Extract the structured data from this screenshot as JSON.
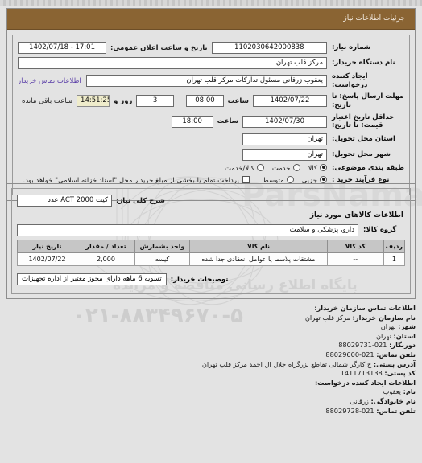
{
  "header": {
    "title": "جزئیات اطلاعات نیاز"
  },
  "fields": {
    "need_number_label": "شماره نیاز:",
    "need_number_value": "1102030642000838",
    "announce_label": "تاریخ و ساعت اعلان عمومی:",
    "announce_value": "1402/07/18 - 17:01",
    "buyer_org_label": "نام دستگاه خریدار:",
    "buyer_org_value": "مرکز قلب تهران",
    "creator_label": "ایجاد کننده درخواست:",
    "creator_value": "یعقوب زرقانی مسئول تدارکات مرکز قلب تهران",
    "contact_link": "اطلاعات تماس خریدار",
    "deadline_label": "مهلت ارسال پاسخ: تا تاریخ:",
    "deadline_date": "1402/07/22",
    "hour_label": "ساعت",
    "deadline_time": "08:00",
    "days_value": "3",
    "days_label": "روز و",
    "remaining_time": "14:51:25",
    "remaining_label": "ساعت باقی مانده",
    "valid_label": "حداقل تاریخ اعتبار قیمت: تا تاریخ:",
    "valid_date": "1402/07/30",
    "valid_time": "18:00",
    "province_label": "استان محل تحویل:",
    "province_value": "تهران",
    "city_label": "شهر محل تحویل:",
    "city_value": "تهران",
    "classification_label": "طبقه بندی موضوعی:",
    "process_label": "نوع فرآیند خرید :",
    "checkbox_text": "پرداخت تمام یا بخشی از مبلغ خریدار محل \"اسناد خزانه اسلامی\" خواهد بود."
  },
  "classification_options": [
    {
      "label": "کالا",
      "selected": true
    },
    {
      "label": "خدمت",
      "selected": false
    },
    {
      "label": "کالا/خدمت",
      "selected": false
    }
  ],
  "process_options": [
    {
      "label": "جزیی",
      "selected": true
    },
    {
      "label": "متوسط",
      "selected": false
    }
  ],
  "summary": {
    "need_summary_label": "شرح کلی نیاز:",
    "need_summary_value": "کیت ACT 2000 عدد",
    "goods_info_title": "اطلاعات کالاهای مورد نیاز",
    "group_label": "گروه کالا:",
    "group_value": "دارو، پزشکی و سلامت"
  },
  "table": {
    "headers": [
      "ردیف",
      "کد کالا",
      "نام کالا",
      "واحد بشمارش",
      "تعداد / مقدار",
      "تاریخ نیاز"
    ],
    "rows": [
      {
        "index": "1",
        "code": "--",
        "name": "مشتقات پلاسما یا عوامل انعقادی جدا شده",
        "unit": "کیسه",
        "quantity": "2,000",
        "need_date": "1402/07/22"
      }
    ]
  },
  "notes": {
    "label": "توضیحات خریدار:",
    "value": "تسویه 6 ماهه دارای مجوز معتبر از اداره تجهیزات"
  },
  "footer": {
    "contact_title": "اطلاعات تماس سازمان خریدار:",
    "org_label": "نام سازمان خریدار:",
    "org_value": "مرکز قلب تهران",
    "city_label": "شهر:",
    "city_value": "تهران",
    "province_label": "استان:",
    "province_value": "تهران",
    "fax_label": "دورنگار:",
    "fax_value": "88029731-021",
    "phone_label": "تلفن تماس:",
    "phone_value": "88029600-021",
    "address_label": "آدرس پستی:",
    "address_value": "خ کارگر شمالی تقاطع بزرگراه جلال ال احمد مرکز قلب تهران",
    "postal_label": "کد پستی:",
    "postal_value": "1411713138",
    "requester_title": "اطلاعات ایجاد کننده درخواست:",
    "fname_label": "نام:",
    "fname_value": "یعقوب",
    "lname_label": "نام خانوادگی:",
    "lname_value": "زرقانی",
    "rphone_label": "تلفن تماس:",
    "rphone_value": "88029728-021"
  },
  "watermark": {
    "brand": "ParsNamadData",
    "phone": "۰۲۱-۸۸۳۴۹۶۷۰-۵",
    "site": "پایگاه اطلاع رسانی مناقصه و مزایده"
  },
  "colors": {
    "header_brown": "#8a6433",
    "link_purple": "#5b3fa8",
    "highlight": "#efeccb"
  }
}
